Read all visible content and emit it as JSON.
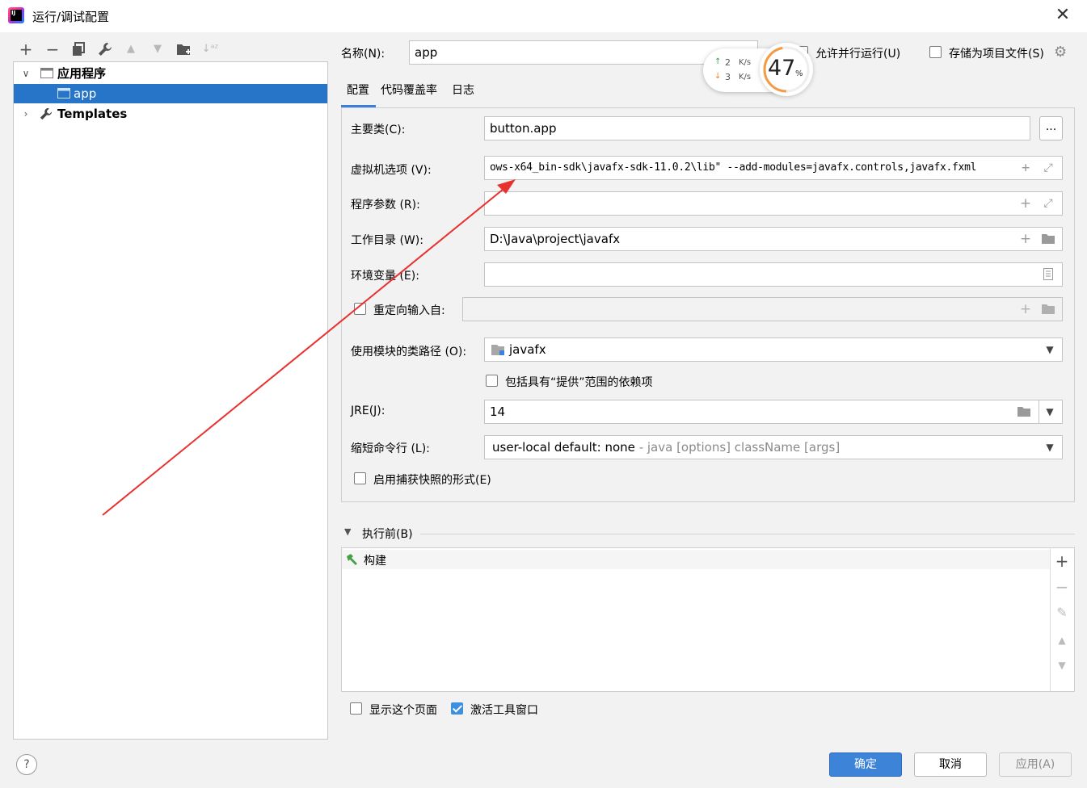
{
  "window": {
    "title": "运行/调试配置",
    "close_glyph": "✕"
  },
  "toolbar": {
    "add": "+",
    "remove": "−",
    "copy": "⧉",
    "edit": "🔧",
    "up": "▲",
    "down": "▼",
    "folder": "📁",
    "sort": "↓ᵃᶻ"
  },
  "tree": {
    "group_label": "应用程序",
    "item_label": "app",
    "templates_label": "Templates"
  },
  "name_field": {
    "label": "名称(N):",
    "value": "app"
  },
  "allow_parallel": {
    "label": "允许并行运行(U)",
    "checked": false
  },
  "store_as_file": {
    "label": "存储为项目文件(S)",
    "checked": false
  },
  "network_widget": {
    "up_value": "2",
    "up_unit": "K/s",
    "down_value": "3",
    "down_unit": "K/s",
    "percent": "47",
    "percent_sign": "%"
  },
  "tabs": [
    "配置",
    "代码覆盖率",
    "日志"
  ],
  "form": {
    "main_class": {
      "label": "主要类(C):",
      "value": "button.app",
      "browse": "..."
    },
    "vm_options": {
      "label": "虚拟机选项 (V):",
      "value": "ows-x64_bin-sdk\\javafx-sdk-11.0.2\\lib\" --add-modules=javafx.controls,javafx.fxml"
    },
    "program_args": {
      "label": "程序参数 (R):",
      "value": ""
    },
    "working_dir": {
      "label": "工作目录 (W):",
      "value": "D:\\Java\\project\\javafx"
    },
    "env_vars": {
      "label": "环境变量 (E):",
      "value": ""
    },
    "redirect_input": {
      "label": "重定向输入自:",
      "checked": false,
      "value": ""
    },
    "module_classpath": {
      "label": "使用模块的类路径 (O):",
      "value": "javafx"
    },
    "include_provided": {
      "label": "包括具有“提供”范围的依赖项",
      "checked": false
    },
    "jre": {
      "label": "JRE(J):",
      "value": "14"
    },
    "shorten_cmd": {
      "label": "缩短命令行 (L):",
      "value": "user-local default: none",
      "hint": " - java [options] className [args]"
    },
    "snapshot": {
      "label": "启用捕获快照的形式(E)",
      "checked": false
    }
  },
  "before_launch": {
    "header": "执行前(B)",
    "items": [
      "构建"
    ]
  },
  "show_page": {
    "label": "显示这个页面",
    "checked": false
  },
  "activate_tool": {
    "label": "激活工具窗口",
    "checked": true
  },
  "buttons": {
    "help": "?",
    "ok": "确定",
    "cancel": "取消",
    "apply": "应用(A)"
  },
  "colors": {
    "accent": "#2675c9",
    "arrow": "#e8312f",
    "ring": "#f39c46"
  }
}
